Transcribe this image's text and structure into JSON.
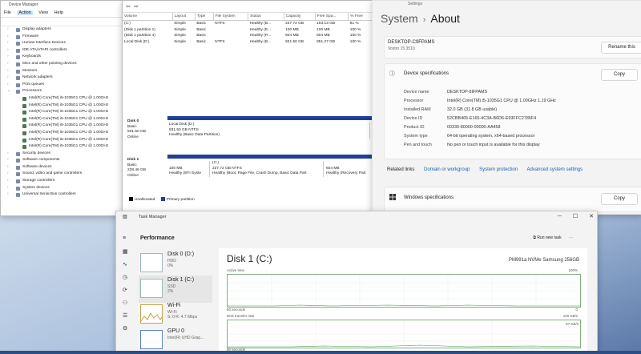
{
  "device_manager": {
    "title": "Device Manager",
    "menu": [
      "File",
      "Action",
      "View",
      "Help"
    ],
    "items": [
      {
        "label": "Display adapters",
        "kind": "collapsed"
      },
      {
        "label": "Firmware",
        "kind": "collapsed"
      },
      {
        "label": "Human Interface Devices",
        "kind": "collapsed"
      },
      {
        "label": "IDE ATA/ATAPI controllers",
        "kind": "collapsed"
      },
      {
        "label": "Keyboards",
        "kind": "collapsed"
      },
      {
        "label": "Mice and other pointing devices",
        "kind": "collapsed"
      },
      {
        "label": "Monitors",
        "kind": "collapsed"
      },
      {
        "label": "Network adapters",
        "kind": "collapsed"
      },
      {
        "label": "Print queues",
        "kind": "collapsed"
      },
      {
        "label": "Processors",
        "kind": "expanded"
      },
      {
        "label": "Intel(R) Core(TM) i5-1035G1 CPU @ 1.00GHz",
        "kind": "child"
      },
      {
        "label": "Intel(R) Core(TM) i5-1035G1 CPU @ 1.00GHz",
        "kind": "child"
      },
      {
        "label": "Intel(R) Core(TM) i5-1035G1 CPU @ 1.00GHz",
        "kind": "child"
      },
      {
        "label": "Intel(R) Core(TM) i5-1035G1 CPU @ 1.00GHz",
        "kind": "child"
      },
      {
        "label": "Intel(R) Core(TM) i5-1035G1 CPU @ 1.00GHz",
        "kind": "child"
      },
      {
        "label": "Intel(R) Core(TM) i5-1035G1 CPU @ 1.00GHz",
        "kind": "child"
      },
      {
        "label": "Intel(R) Core(TM) i5-1035G1 CPU @ 1.00GHz",
        "kind": "child"
      },
      {
        "label": "Intel(R) Core(TM) i5-1035G1 CPU @ 1.00GHz",
        "kind": "child"
      },
      {
        "label": "Security devices",
        "kind": "collapsed"
      },
      {
        "label": "Software components",
        "kind": "collapsed"
      },
      {
        "label": "Software devices",
        "kind": "collapsed"
      },
      {
        "label": "Sound, video and game controllers",
        "kind": "collapsed"
      },
      {
        "label": "Storage controllers",
        "kind": "collapsed"
      },
      {
        "label": "System devices",
        "kind": "collapsed"
      },
      {
        "label": "Universal Serial Bus controllers",
        "kind": "collapsed"
      }
    ]
  },
  "disk_mgmt": {
    "columns": [
      "Volume",
      "Layout",
      "Type",
      "File System",
      "Status",
      "Capacity",
      "Free Spa...",
      "% Free"
    ],
    "rows": [
      [
        "(C:)",
        "Simple",
        "Basic",
        "NTFS",
        "Healthy (B...",
        "237.72 GB",
        "193.13 GB",
        "81 %"
      ],
      [
        "(Disk 1 partition 1)",
        "Simple",
        "Basic",
        "",
        "Healthy (E...",
        "100 MB",
        "100 MB",
        "100 %"
      ],
      [
        "(Disk 1 partition 4)",
        "Simple",
        "Basic",
        "",
        "Healthy (R...",
        "604 MB",
        "604 MB",
        "100 %"
      ],
      [
        "Local Disk (D:)",
        "Simple",
        "Basic",
        "NTFS",
        "Healthy (B...",
        "931.50 GB",
        "851.27 GB",
        "100 %"
      ]
    ],
    "disk0": {
      "name": "Disk 0",
      "type": "Basic",
      "size": "931.50 GB",
      "status": "Online",
      "partition": {
        "name": "Local Disk (D:)",
        "size": "931.50 GB NTFS",
        "status": "Healthy (Basic Data Partition)"
      }
    },
    "disk1": {
      "name": "Disk 1",
      "type": "Basic",
      "size": "238.46 GB",
      "status": "Online",
      "partitions": [
        {
          "name": "",
          "size": "100 MB",
          "status": "Healthy (EFI Syste"
        },
        {
          "name": "(C:)",
          "size": "237.72 GB NTFS",
          "status": "Healthy (Boot, Page File, Crash Dump, Basic Data Part"
        },
        {
          "name": "",
          "size": "604 MB",
          "status": "Healthy (Recovery Part"
        }
      ]
    },
    "legend": [
      "Unallocated",
      "Primary partition"
    ]
  },
  "settings": {
    "window_title": "Settings",
    "crumb_parent": "System",
    "crumb_current": "About",
    "device_name": "DESKTOP-C9FPAMS",
    "device_sub": "Vostro 15 3510",
    "rename_label": "Rename this",
    "spec_title": "Device specifications",
    "copy_label": "Copy",
    "specs": [
      {
        "label": "Device name",
        "value": "DESKTOP-8IFPAMS"
      },
      {
        "label": "Processor",
        "value": "Intel(R) Core(TM) i5-1035G1 CPU @ 1.00GHz   1.19 GHz"
      },
      {
        "label": "Installed RAM",
        "value": "32.0 GB (31.8 GB usable)"
      },
      {
        "label": "Device ID",
        "value": "52CBB465-E165-4C3A-B6D6-E93FFC2785F4"
      },
      {
        "label": "Product ID",
        "value": "00330-80000-00000-AA458"
      },
      {
        "label": "System type",
        "value": "64-bit operating system, x64-based processor"
      },
      {
        "label": "Pen and touch",
        "value": "No pen or touch input is available for this display"
      }
    ],
    "related_label": "Related links",
    "links": [
      "Domain or workgroup",
      "System protection",
      "Advanced system settings"
    ],
    "win_spec_title": "Windows specifications",
    "copy2_label": "Copy"
  },
  "task_manager": {
    "title": "Task Manager",
    "section": "Performance",
    "run_task": "Run new task",
    "resources": [
      {
        "name": "Disk 0 (D:)",
        "sub1": "HDD",
        "sub2": "0%"
      },
      {
        "name": "Disk 1 (C:)",
        "sub1": "SSD",
        "sub2": "2%"
      },
      {
        "name": "Wi-Fi",
        "sub1": "Wi-Fi",
        "sub2": "S: 0 R: 4.7 Mbps"
      },
      {
        "name": "GPU 0",
        "sub1": "Intel(R) UHD Grap...",
        "sub2": ""
      }
    ],
    "main_title": "Disk 1 (C:)",
    "model": "PM991a NVMe Samsung 256GB",
    "active_time": "Active time",
    "pct_100": "100%",
    "seconds": "60 seconds",
    "zero": "0",
    "transfer": "Disk transfer rate",
    "kbs": "100 KB/s",
    "kbs2": "67 KB/s",
    "seconds2": "60 seconds"
  }
}
